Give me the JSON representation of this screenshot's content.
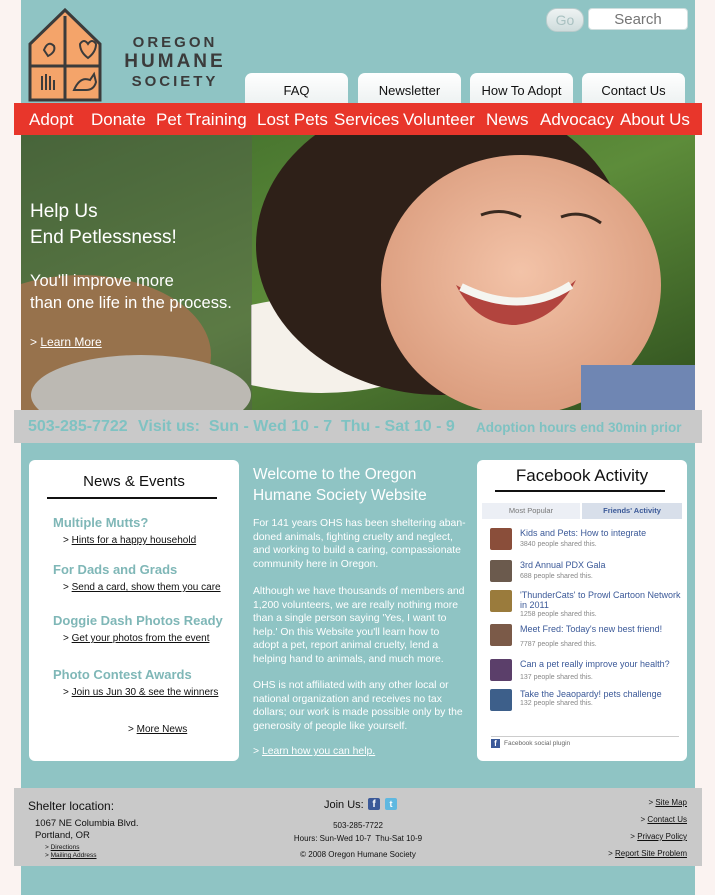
{
  "org": {
    "line1": "OREGON",
    "line2": "HUMANE",
    "line3": "SOCIETY"
  },
  "search": {
    "go_label": "Go",
    "placeholder": "Search"
  },
  "top_tabs": [
    "FAQ",
    "Newsletter",
    "How To Adopt",
    "Contact Us"
  ],
  "nav": [
    "Adopt",
    "Donate",
    "Pet Training",
    "Lost Pets",
    "Services",
    "Volunteer",
    "News",
    "Advocacy",
    "About Us"
  ],
  "hero": {
    "headline1": "Help Us",
    "headline2": "End Petlessness!",
    "sub1": "You'll improve more",
    "sub2": "than one life in the process.",
    "link_prefix": "> ",
    "link": "Learn More"
  },
  "hours_bar": {
    "phone": "503-285-7722",
    "visit": "Visit us:  Sun - Wed 10 - 7  Thu - Sat 10 - 9",
    "note": "Adoption hours end 30min prior"
  },
  "news": {
    "title": "News & Events",
    "items": [
      {
        "heading": "Multiple Mutts?",
        "link": "Hints for a happy household"
      },
      {
        "heading": "For Dads and Grads",
        "link": "Send a card, show them you care"
      },
      {
        "heading": "Doggie Dash Photos Ready",
        "link": "Get your photos from the event"
      },
      {
        "heading": "Photo Contest Awards",
        "link": "Join us Jun 30 & see the winners"
      }
    ],
    "more": "More News",
    "arrow": ">"
  },
  "welcome": {
    "title": "Welcome to the Oregon Humane Society Website",
    "p1": "For 141 years OHS has been sheltering aban-doned animals, fighting cruelty and neglect, and working to build a caring, compassionate community here in Oregon.",
    "p2": "Although we have thousands of members and 1,200 volunteers, we are really nothing more than a single person saying 'Yes, I want to help.' On this Website you'll learn how to adopt a pet, report animal cruelty, lend a helping hand to animals, and much more.",
    "p3": "OHS is not affiliated with any other local or national organization and receives no tax dollars; our work is made possible only by the generosity of people like yourself.",
    "link": "Learn how you can help."
  },
  "facebook": {
    "title": "Facebook Activity",
    "tab_popular": "Most Popular",
    "tab_friends": "Friends' Activity",
    "items": [
      {
        "title": "Kids and Pets: How to integrate",
        "shares": "3840 people shared this."
      },
      {
        "title": "3rd Annual PDX Gala",
        "shares": "688 people shared this."
      },
      {
        "title": "'ThunderCats' to Prowl Cartoon Network",
        "title2": "in 2011",
        "shares": "1258 people shared this."
      },
      {
        "title": "Meet Fred: Today's new best friend!",
        "shares": "7787 people shared this."
      },
      {
        "title": "Can a pet really improve your health?",
        "shares": "137 people shared this."
      },
      {
        "title": "Take the Jeaopardy! pets challenge",
        "shares": "132 people shared this."
      }
    ],
    "plugin": "Facebook social plugin"
  },
  "footer": {
    "shelter_label": "Shelter location:",
    "address1": "1067 NE Columbia Blvd.",
    "address2": "Portland, OR",
    "directions": "Directions",
    "mailing": "Mailing Address",
    "join": "Join Us:",
    "phone": "503-285-7722",
    "hours": "Hours: Sun-Wed 10-7  Thu-Sat 10-9",
    "copyright": "© 2008 Oregon Humane Society",
    "links": [
      "Site Map",
      "Contact Us",
      "Privacy Policy",
      "Report Site Problem"
    ]
  },
  "colors": {
    "teal": "#8fc4c4",
    "nav_red": "#e8362b",
    "grey_bar": "#c9c9c9",
    "accent_text": "#7fc2c2",
    "logo_orange": "#f4a46a"
  }
}
